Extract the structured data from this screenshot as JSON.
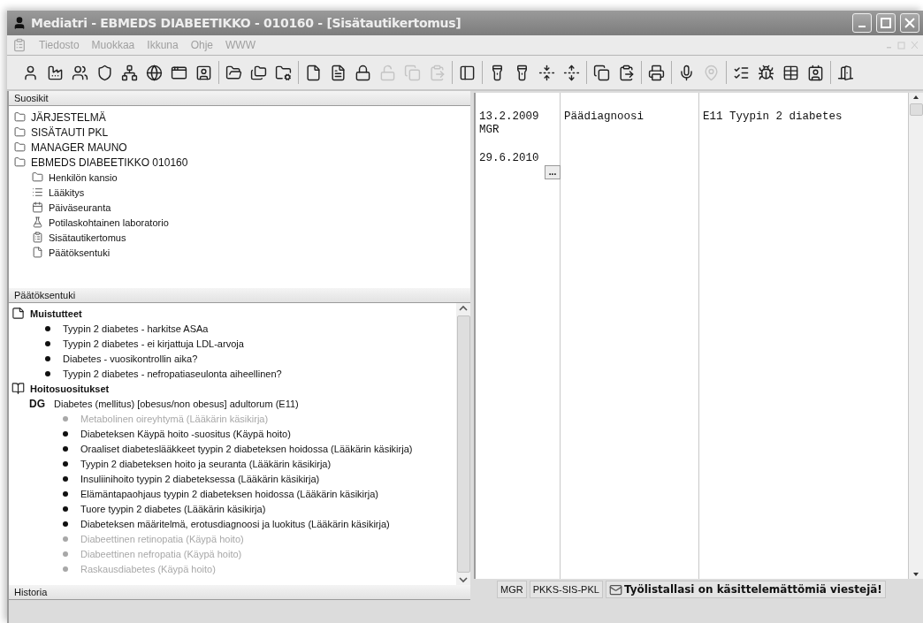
{
  "window": {
    "title": "Mediatri - EBMEDS DIABEETIKKO - 010160 - [Sisätautikertomus]"
  },
  "menu": [
    {
      "label": "Tiedosto"
    },
    {
      "label": "Muokkaa"
    },
    {
      "label": "Ikkuna"
    },
    {
      "label": "Ohje"
    },
    {
      "label": "WWW"
    }
  ],
  "toolbar": [
    [
      {
        "kind": "person",
        "disabled": false
      },
      {
        "kind": "factory",
        "disabled": false
      },
      {
        "kind": "people",
        "disabled": false
      },
      {
        "kind": "shield",
        "disabled": false
      },
      {
        "kind": "network",
        "disabled": false
      },
      {
        "kind": "globe",
        "disabled": false
      },
      {
        "kind": "window",
        "disabled": false
      },
      {
        "kind": "portrait",
        "disabled": false
      }
    ],
    [
      {
        "kind": "folder",
        "disabled": false
      },
      {
        "kind": "folders",
        "disabled": false
      },
      {
        "kind": "folder-gear",
        "disabled": false
      }
    ],
    [
      {
        "kind": "document",
        "disabled": false
      },
      {
        "kind": "document-text",
        "disabled": false
      },
      {
        "kind": "lock",
        "disabled": false
      },
      {
        "kind": "unlock",
        "disabled": true
      },
      {
        "kind": "copy",
        "disabled": true
      },
      {
        "kind": "paste",
        "disabled": true
      }
    ],
    [
      {
        "kind": "form",
        "disabled": false
      }
    ],
    [
      {
        "kind": "flashlight",
        "disabled": false
      },
      {
        "kind": "flashlight",
        "disabled": false
      },
      {
        "kind": "collapse",
        "disabled": false
      },
      {
        "kind": "expand",
        "disabled": false
      }
    ],
    [
      {
        "kind": "copy",
        "disabled": false
      },
      {
        "kind": "paste",
        "disabled": false
      }
    ],
    [
      {
        "kind": "printer",
        "disabled": false
      }
    ],
    [
      {
        "kind": "microphone",
        "disabled": false
      },
      {
        "kind": "pin",
        "disabled": true
      }
    ],
    [
      {
        "kind": "list",
        "disabled": false
      },
      {
        "kind": "bug",
        "disabled": false
      },
      {
        "kind": "table",
        "disabled": false
      },
      {
        "kind": "contact",
        "disabled": false
      }
    ],
    [
      {
        "kind": "door",
        "disabled": false
      }
    ]
  ],
  "favorites": {
    "title": "Suosikit",
    "items": [
      {
        "label": "JÄRJESTELMÄ",
        "kind": "folder"
      },
      {
        "label": "SISÄTAUTI PKL",
        "kind": "folder"
      },
      {
        "label": "MANAGER MAUNO",
        "kind": "folder"
      },
      {
        "label": "EBMEDS DIABEETIKKO  010160",
        "kind": "folder",
        "children": [
          {
            "label": "Henkilön kansio",
            "kind": "folder"
          },
          {
            "label": "Lääkitys",
            "kind": "list"
          },
          {
            "label": "Päiväseuranta",
            "kind": "calendar"
          },
          {
            "label": "Potilaskohtainen laboratorio",
            "kind": "lab"
          },
          {
            "label": "Sisätautikertomus",
            "kind": "form"
          },
          {
            "label": "Päätöksentuki",
            "kind": "page"
          }
        ]
      }
    ]
  },
  "decision_support": {
    "title": "Päätöksentuki",
    "sections": [
      {
        "title": "Muistutteet",
        "kind": "note",
        "items": [
          {
            "label": "Tyypin 2 diabetes - harkitse ASAa",
            "disabled": false
          },
          {
            "label": "Tyypin 2 diabetes - ei kirjattuja LDL-arvoja",
            "disabled": false
          },
          {
            "label": "Diabetes - vuosikontrollin aika?",
            "disabled": false
          },
          {
            "label": "Tyypin 2 diabetes - nefropatiaseulonta aiheellinen?",
            "disabled": false
          }
        ]
      },
      {
        "title": "Hoitosuositukset",
        "kind": "book",
        "diagnosis": {
          "code": "DG",
          "label": "Diabetes (mellitus) [obesus/non obesus] adultorum  (E11)"
        },
        "items": [
          {
            "label": "Metabolinen oireyhtymä (Lääkärin käsikirja)",
            "disabled": true
          },
          {
            "label": "Diabeteksen Käypä hoito -suositus (Käypä hoito)",
            "disabled": false
          },
          {
            "label": "Oraaliset diabeteslääkkeet tyypin 2 diabeteksen hoidossa (Lääkärin käsikirja)",
            "disabled": false
          },
          {
            "label": "Tyypin 2 diabeteksen hoito ja seuranta (Lääkärin käsikirja)",
            "disabled": false
          },
          {
            "label": "Insuliinihoito tyypin 2 diabeteksessa (Lääkärin käsikirja)",
            "disabled": false
          },
          {
            "label": "Elämäntapaohjaus tyypin 2 diabeteksen hoidossa (Lääkärin käsikirja)",
            "disabled": false
          },
          {
            "label": "Tuore tyypin 2 diabetes (Lääkärin käsikirja)",
            "disabled": false
          },
          {
            "label": "Diabeteksen määritelmä, erotusdiagnoosi ja luokitus (Lääkärin käsikirja)",
            "disabled": false
          },
          {
            "label": "Diabeettinen retinopatia (Käypä hoito)",
            "disabled": true
          },
          {
            "label": "Diabeettinen nefropatia (Käypä hoito)",
            "disabled": true
          },
          {
            "label": "Raskausdiabetes (Käypä hoito)",
            "disabled": true
          }
        ]
      }
    ]
  },
  "history": {
    "title": "Historia"
  },
  "record": {
    "rows": [
      {
        "date": "13.2.2009",
        "author": "MGR",
        "type": "Päädiagnoosi",
        "text": "E11 Tyypin 2 diabetes"
      },
      {
        "date": "29.6.2010",
        "more": "..."
      }
    ]
  },
  "status_bar": {
    "user": "MGR",
    "unit": "PKKS-SIS-PKL",
    "message": "Työlistallasi on käsittelemättömiä viestejä!"
  }
}
